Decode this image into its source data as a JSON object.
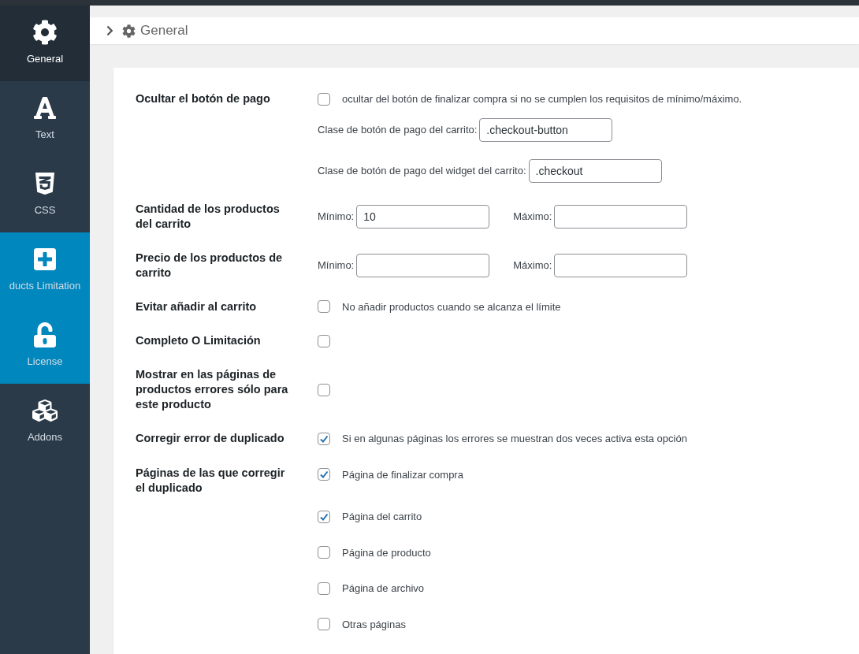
{
  "sidebar": {
    "items": [
      {
        "label": "General",
        "selected": true,
        "highlighted": false
      },
      {
        "label": "Text",
        "selected": false,
        "highlighted": false
      },
      {
        "label": "CSS",
        "selected": false,
        "highlighted": false
      },
      {
        "label": "ducts Limitation",
        "selected": false,
        "highlighted": true
      },
      {
        "label": "License",
        "selected": false,
        "highlighted": true
      },
      {
        "label": "Addons",
        "selected": false,
        "highlighted": false
      }
    ]
  },
  "breadcrumb": {
    "title": "General"
  },
  "settings": [
    {
      "kind": "checkbox",
      "label": "Ocultar el botón de pago",
      "checked": false,
      "text": "ocultar del botón de finalizar compra si no se cumplen los requisitos de mínimo/máximo.",
      "fields": [
        {
          "label": "Clase de botón de pago del carrito:",
          "value": ".checkout-button"
        },
        {
          "label": "Clase de botón de pago del widget del carrito:",
          "value": ".checkout"
        }
      ]
    },
    {
      "kind": "minmax",
      "label": "Cantidad de los productos del carrito",
      "fields": [
        {
          "label": "Mínimo:",
          "value": "10"
        },
        {
          "label": "Máximo:"
        }
      ]
    },
    {
      "kind": "minmax",
      "label": "Precio de los productos de carrito",
      "fields": [
        {
          "label": "Mínimo:"
        },
        {
          "label": "Máximo:"
        }
      ]
    },
    {
      "kind": "checkbox",
      "label": "Evitar añadir al carrito",
      "checked": false,
      "text": "No añadir productos cuando se alcanza el límite"
    },
    {
      "kind": "checkbox",
      "label": "Completo O Limitación",
      "checked": false
    },
    {
      "kind": "checkbox",
      "label": "Mostrar en las páginas de productos errores sólo para este producto",
      "checked": false
    },
    {
      "kind": "checkbox",
      "label": "Corregir error de duplicado",
      "checked": true,
      "text": "Si en algunas páginas los errores se muestran dos veces activa esta opción"
    },
    {
      "kind": "checklist",
      "label": "Páginas de las que corregir el duplicado",
      "options": [
        {
          "label": "Página de finalizar compra",
          "checked": true
        },
        {
          "label": "Página del carrito",
          "checked": true
        },
        {
          "label": "Página de producto",
          "checked": false
        },
        {
          "label": "Página de archivo",
          "checked": false
        },
        {
          "label": "Otras páginas",
          "checked": false
        }
      ]
    }
  ]
}
